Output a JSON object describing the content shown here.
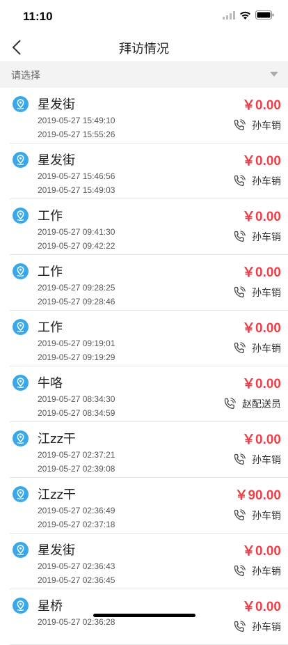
{
  "status": {
    "time": "11:10"
  },
  "nav": {
    "title": "拜访情况"
  },
  "filter": {
    "label": "请选择"
  },
  "visits": [
    {
      "place": "星发街",
      "time_start": "2019-05-27 15:49:10",
      "time_end": "2019-05-27 15:55:26",
      "amount": "￥0.00",
      "person": "孙车销"
    },
    {
      "place": "星发街",
      "time_start": "2019-05-27 15:46:56",
      "time_end": "2019-05-27 15:49:03",
      "amount": "￥0.00",
      "person": "孙车销"
    },
    {
      "place": "工作",
      "time_start": "2019-05-27 09:41:30",
      "time_end": "2019-05-27 09:42:22",
      "amount": "￥0.00",
      "person": "孙车销"
    },
    {
      "place": "工作",
      "time_start": "2019-05-27 09:28:25",
      "time_end": "2019-05-27 09:28:46",
      "amount": "￥0.00",
      "person": "孙车销"
    },
    {
      "place": "工作",
      "time_start": "2019-05-27 09:19:01",
      "time_end": "2019-05-27 09:19:29",
      "amount": "￥0.00",
      "person": "孙车销"
    },
    {
      "place": "牛咯",
      "time_start": "2019-05-27 08:34:30",
      "time_end": "2019-05-27 08:34:59",
      "amount": "￥0.00",
      "person": "赵配送员"
    },
    {
      "place": "江zz干",
      "time_start": "2019-05-27 02:37:21",
      "time_end": "2019-05-27 02:39:08",
      "amount": "￥0.00",
      "person": "孙车销"
    },
    {
      "place": "江zz干",
      "time_start": "2019-05-27 02:36:49",
      "time_end": "2019-05-27 02:37:18",
      "amount": "￥90.00",
      "person": "孙车销"
    },
    {
      "place": "星发街",
      "time_start": "2019-05-27 02:36:43",
      "time_end": "2019-05-27 02:36:45",
      "amount": "￥0.00",
      "person": "孙车销"
    },
    {
      "place": "星桥",
      "time_start": "2019-05-27 02:36:28",
      "time_end": "",
      "amount": "￥0.00",
      "person": "孙车销"
    }
  ],
  "colors": {
    "accent_red": "#e8424a",
    "pin_blue": "#3aa8e8"
  }
}
